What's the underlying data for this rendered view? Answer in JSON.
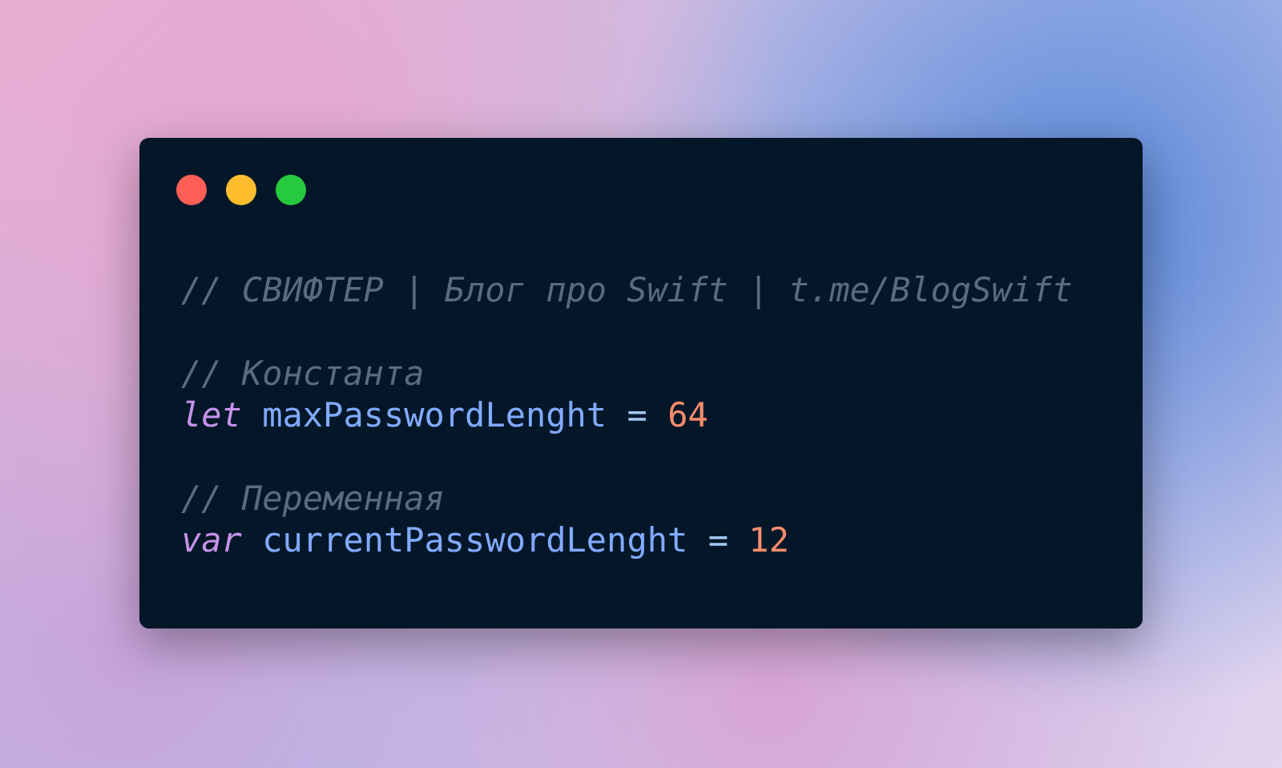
{
  "window": {
    "buttons": [
      {
        "kind": "close"
      },
      {
        "kind": "minimize"
      },
      {
        "kind": "zoom"
      }
    ]
  },
  "code_blocks": [
    [
      {
        "tokens": [
          {
            "kind": "comment",
            "text": "// СВИФТЕР | Блог про Swift | t.me/BlogSwift"
          }
        ]
      }
    ],
    [
      {
        "tokens": [
          {
            "kind": "comment",
            "text": "// Константа"
          }
        ]
      },
      {
        "tokens": [
          {
            "kind": "keyword",
            "text": "let"
          },
          {
            "kind": "identifier",
            "text": "maxPasswordLenght"
          },
          {
            "kind": "operator",
            "text": "="
          },
          {
            "kind": "number",
            "text": "64"
          }
        ]
      }
    ],
    [
      {
        "tokens": [
          {
            "kind": "comment",
            "text": "// Переменная"
          }
        ]
      },
      {
        "tokens": [
          {
            "kind": "keyword",
            "text": "var"
          },
          {
            "kind": "identifier",
            "text": "currentPasswordLenght"
          },
          {
            "kind": "operator",
            "text": "="
          },
          {
            "kind": "number",
            "text": "12"
          }
        ]
      }
    ]
  ]
}
